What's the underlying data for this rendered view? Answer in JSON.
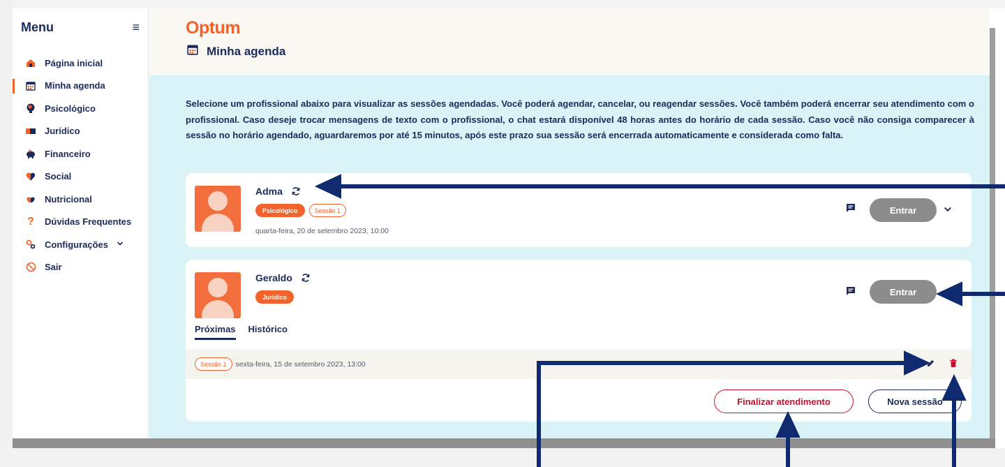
{
  "sidebar": {
    "title": "Menu",
    "items": [
      {
        "label": "Página inicial",
        "icon": "home-icon"
      },
      {
        "label": "Minha agenda",
        "icon": "calendar-icon",
        "active": true
      },
      {
        "label": "Psicológico",
        "icon": "head-icon"
      },
      {
        "label": "Jurídico",
        "icon": "book-icon"
      },
      {
        "label": "Financeiro",
        "icon": "piggy-bank-icon"
      },
      {
        "label": "Social",
        "icon": "heart-icon"
      },
      {
        "label": "Nutricional",
        "icon": "apple-icon"
      },
      {
        "label": "Dúvidas Frequentes",
        "icon": "question-icon"
      },
      {
        "label": "Configurações",
        "icon": "gear-icon",
        "has_submenu": true
      },
      {
        "label": "Sair",
        "icon": "logout-icon"
      }
    ]
  },
  "header": {
    "logo": "Optum",
    "page_title": "Minha agenda"
  },
  "main": {
    "intro": "Selecione um profissional abaixo para visualizar as sessões agendadas. Você poderá agendar, cancelar, ou reagendar sessões. Você também poderá encerrar seu atendimento com o profissional. Caso deseje trocar mensagens de texto com o profissional, o chat estará disponível 48 horas antes do horário de cada sessão. Caso você não consiga comparecer à sessão no horário agendado, aguardaremos por até 15 minutos, após este prazo sua sessão será encerrada automaticamente e considerada como falta.",
    "cards": [
      {
        "name": "Adma",
        "specialty": "Psicológico",
        "session_tag": "Sessão 1",
        "date": "quarta-feira, 20 de setembro 2023, 10:00",
        "enter_label": "Entrar"
      },
      {
        "name": "Geraldo",
        "specialty": "Jurídico",
        "enter_label": "Entrar",
        "tabs": [
          "Próximas",
          "Histórico"
        ],
        "active_tab": "Próximas",
        "sessions": [
          {
            "tag": "Sessão 1",
            "date": "sexta-feira, 15 de setembro 2023, 13:00"
          }
        ],
        "finalize_label": "Finalizar atendimento",
        "new_session_label": "Nova sessão"
      }
    ]
  },
  "colors": {
    "brand_orange": "#f2622a",
    "navy": "#1b2a5a",
    "main_bg": "#d9f3f7",
    "header_bg": "#faf8f3",
    "danger": "#c8102e",
    "button_gray": "#8c8c8c",
    "annotation_arrow": "#0f2a6e"
  }
}
